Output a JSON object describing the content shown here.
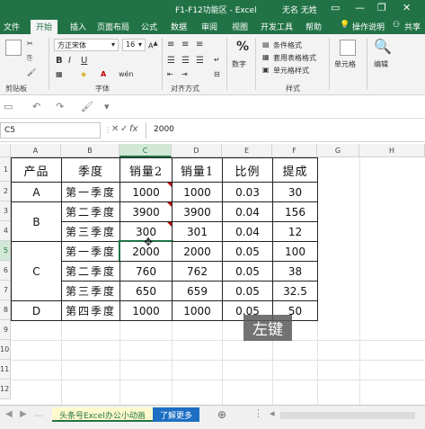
{
  "titlebar": {
    "title": "F1-F12功能区 - Excel",
    "user": "无名 无姓"
  },
  "tabs": [
    "文件",
    "开始",
    "插入",
    "页面布局",
    "公式",
    "数据",
    "审阅",
    "视图",
    "开发工具",
    "帮助"
  ],
  "tabs_right": {
    "help_search": "操作说明",
    "share": "共享"
  },
  "ribbon": {
    "font_name": "方正宋体",
    "font_size": "16",
    "groups": {
      "clipboard": "剪贴板",
      "font": "字体",
      "alignment": "对齐方式",
      "styles": "样式"
    },
    "number": "数字",
    "cond_format": "条件格式",
    "table_format": "套用表格格式",
    "cell_styles": "单元格样式",
    "cells": "单元格",
    "editing": "编辑"
  },
  "formula_bar": {
    "name_box": "C5",
    "fx": "fx",
    "value": "2000"
  },
  "columns": [
    "A",
    "B",
    "C",
    "D",
    "E",
    "F",
    "G",
    "H"
  ],
  "rows": [
    "1",
    "2",
    "3",
    "4",
    "5",
    "6",
    "7",
    "8",
    "9",
    "10",
    "11",
    "12"
  ],
  "table": {
    "headers": [
      "产品",
      "季度",
      "销量2",
      "销量1",
      "比例",
      "提成"
    ],
    "products": [
      "A",
      "B",
      "C",
      "D"
    ],
    "quarters": [
      "第一季度",
      "第二季度",
      "第三季度",
      "第一季度",
      "第二季度",
      "第三季度",
      "第四季度"
    ],
    "sales2": [
      "1000",
      "3900",
      "300",
      "2000",
      "760",
      "650",
      "1000"
    ],
    "sales1": [
      "1000",
      "3900",
      "301",
      "2000",
      "762",
      "659",
      "1000"
    ],
    "ratio": [
      "0.03",
      "0.04",
      "0.04",
      "0.05",
      "0.05",
      "0.05",
      "0.05"
    ],
    "bonus": [
      "30",
      "156",
      "12",
      "100",
      "38",
      "32.5",
      "50"
    ]
  },
  "overlay_text": "左键",
  "sheets": {
    "active": "头条号Excel办公小动画",
    "more": "了解更多"
  },
  "colors": {
    "brand": "#217346",
    "sheet_tab_active": "#fffacd",
    "more_tab": "#1e6fc4"
  }
}
